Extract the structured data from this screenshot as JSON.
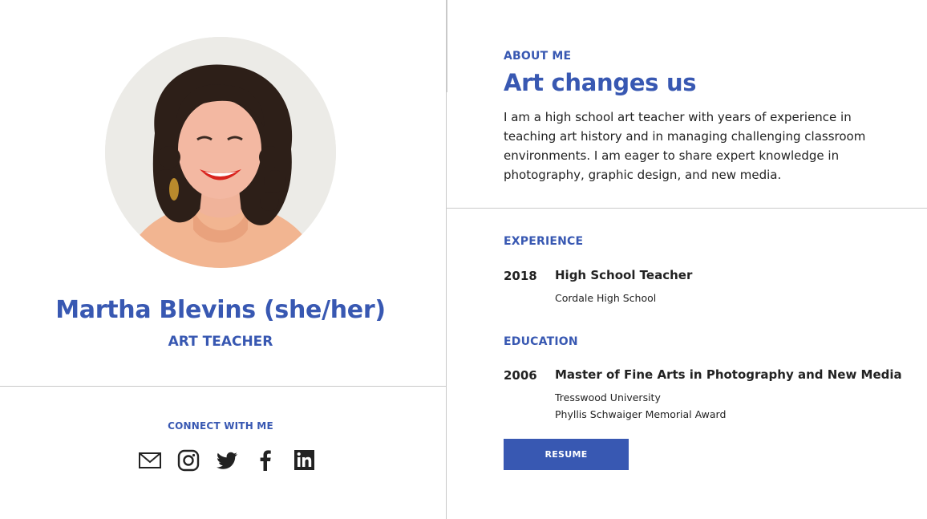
{
  "profile": {
    "name": "Martha Blevins (she/her)",
    "role": "ART TEACHER"
  },
  "connect": {
    "heading": "CONNECT WITH ME",
    "icons": [
      "mail-icon",
      "instagram-icon",
      "twitter-icon",
      "facebook-icon",
      "linkedin-icon"
    ]
  },
  "about": {
    "label": "ABOUT ME",
    "title": "Art changes us",
    "text": "I am a high school art teacher with years of experience in teaching art history and in managing challenging classroom environments. I am eager to share expert knowledge in photography, graphic design, and new media."
  },
  "experience": {
    "label": "EXPERIENCE",
    "items": [
      {
        "year": "2018",
        "title": "High School Teacher",
        "lines": [
          "Cordale High School"
        ]
      }
    ]
  },
  "education": {
    "label": "EDUCATION",
    "items": [
      {
        "year": "2006",
        "title": "Master of Fine Arts in Photography and New Media",
        "lines": [
          "Tresswood University",
          "Phyllis Schwaiger Memorial Award"
        ]
      }
    ]
  },
  "resume_button": {
    "label": "RESUME"
  },
  "colors": {
    "accent": "#3858b2",
    "text": "#222222",
    "divider": "#c9c9c9"
  }
}
